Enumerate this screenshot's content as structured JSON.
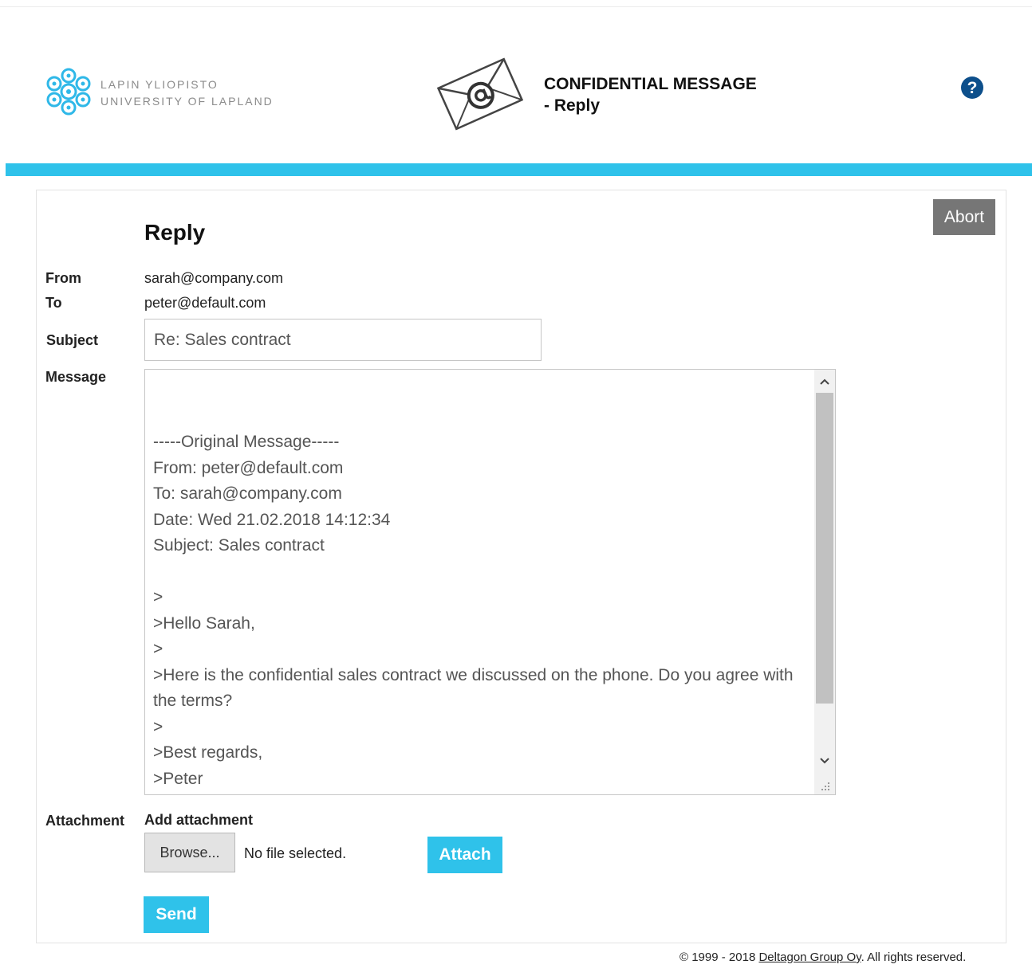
{
  "header": {
    "logo_line1": "LAPIN YLIOPISTO",
    "logo_line2": "UNIVERSITY OF LAPLAND",
    "title_line1": "CONFIDENTIAL MESSAGE",
    "title_line2": "- Reply",
    "help_icon": "question-circle-icon",
    "envelope_icon": "envelope-at-icon",
    "accent_color": "#2fc2ea",
    "logo_color": "#2fb8e8"
  },
  "form": {
    "heading": "Reply",
    "abort_label": "Abort",
    "from_label": "From",
    "from_value": "sarah@company.com",
    "to_label": "To",
    "to_value": "peter@default.com",
    "subject_label": "Subject",
    "subject_value": "Re: Sales contract",
    "message_label": "Message",
    "message_value": "\n\n-----Original Message-----\nFrom: peter@default.com\nTo: sarah@company.com\nDate: Wed 21.02.2018 14:12:34\nSubject: Sales contract\n\n>\n>Hello Sarah,\n>\n>Here is the confidential sales contract we discussed on the phone. Do you agree with the terms?\n>\n>Best regards,\n>Peter",
    "attachment_label": "Attachment",
    "add_attachment_label": "Add attachment",
    "browse_label": "Browse...",
    "no_file_text": "No file selected.",
    "attach_label": "Attach",
    "send_label": "Send"
  },
  "footer": {
    "copyright_prefix": "© 1999 - 2018 ",
    "company_link": "Deltagon Group Oy",
    "suffix": ". All rights reserved."
  }
}
